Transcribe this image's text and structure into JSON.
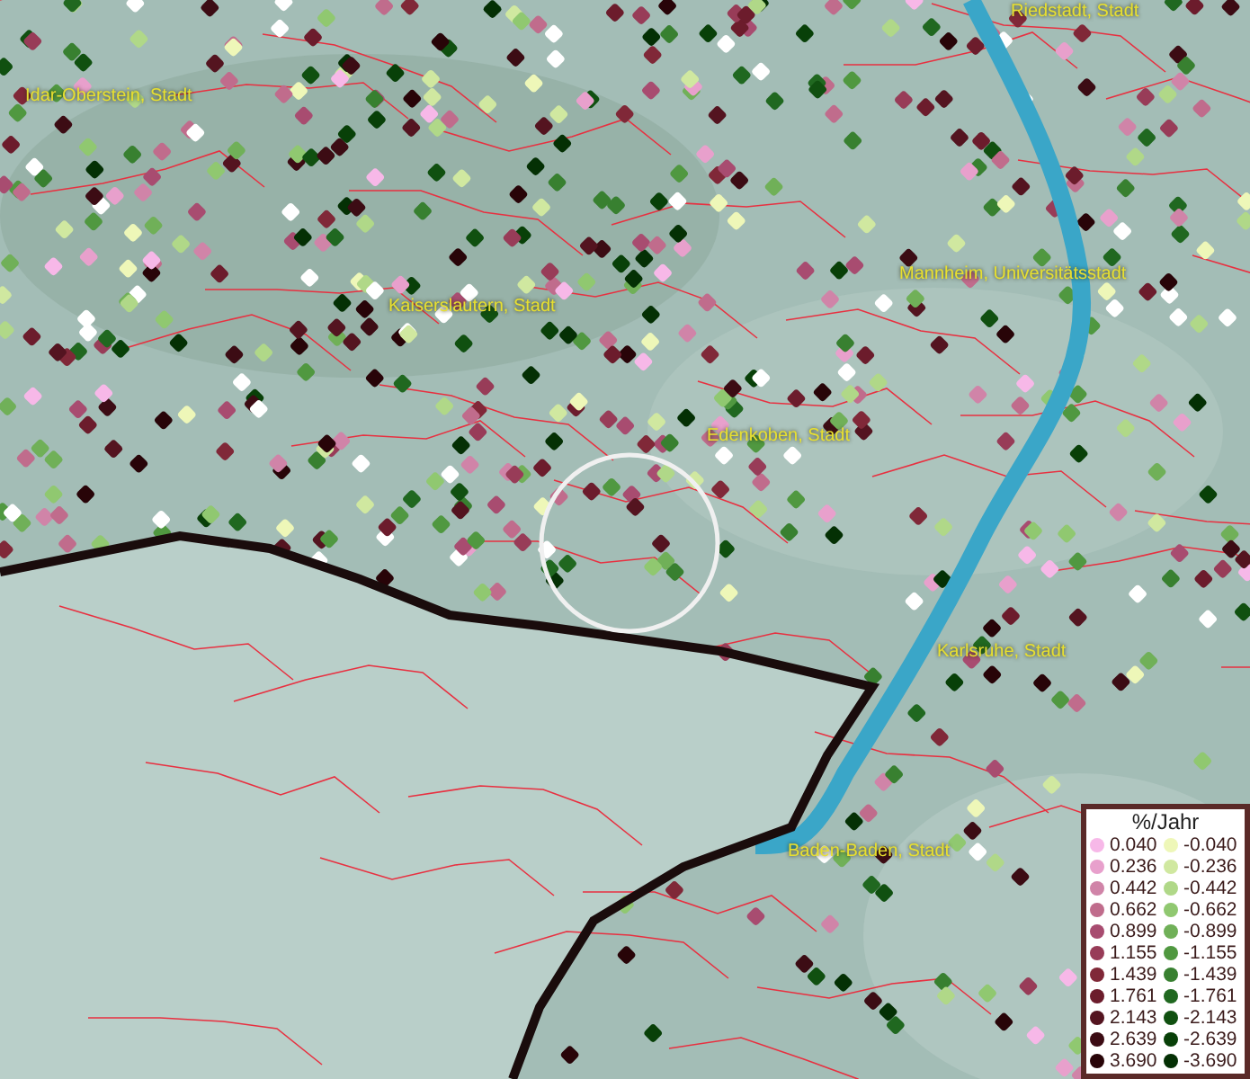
{
  "map": {
    "places": [
      {
        "name": "Riedstadt, Stadt"
      },
      {
        "name": "Idar-Oberstein, Stadt"
      },
      {
        "name": "Mannheim, Universitätsstadt"
      },
      {
        "name": "Kaiserslautern, Stadt"
      },
      {
        "name": "Edenkoben, Stadt"
      },
      {
        "name": "Karlsruhe, Stadt"
      },
      {
        "name": "Baden-Baden, Stadt"
      }
    ]
  },
  "legend": {
    "title": "%/Jahr",
    "rows": [
      {
        "left": {
          "label": "0.040",
          "color": "#f7b8e8"
        },
        "right": {
          "label": "-0.040",
          "color": "#eef7b8"
        }
      },
      {
        "left": {
          "label": "0.236",
          "color": "#e8a0cc"
        },
        "right": {
          "label": "-0.236",
          "color": "#d0e8a0"
        }
      },
      {
        "left": {
          "label": "0.442",
          "color": "#d084a8"
        },
        "right": {
          "label": "-0.442",
          "color": "#b0d888"
        }
      },
      {
        "left": {
          "label": "0.662",
          "color": "#c06c8c"
        },
        "right": {
          "label": "-0.662",
          "color": "#90c870"
        }
      },
      {
        "left": {
          "label": "0.899",
          "color": "#a84c70"
        },
        "right": {
          "label": "-0.899",
          "color": "#70b058"
        }
      },
      {
        "left": {
          "label": "1.155",
          "color": "#983c58"
        },
        "right": {
          "label": "-1.155",
          "color": "#509840"
        }
      },
      {
        "left": {
          "label": "1.439",
          "color": "#802838"
        },
        "right": {
          "label": "-1.439",
          "color": "#388030"
        }
      },
      {
        "left": {
          "label": "1.761",
          "color": "#6c1c2c"
        },
        "right": {
          "label": "-1.761",
          "color": "#206820"
        }
      },
      {
        "left": {
          "label": "2.143",
          "color": "#541420"
        },
        "right": {
          "label": "-2.143",
          "color": "#105010"
        }
      },
      {
        "left": {
          "label": "2.639",
          "color": "#3c0c14"
        },
        "right": {
          "label": "-2.639",
          "color": "#084008"
        }
      },
      {
        "left": {
          "label": "3.690",
          "color": "#280408"
        },
        "right": {
          "label": "-3.690",
          "color": "#043004"
        }
      }
    ]
  }
}
